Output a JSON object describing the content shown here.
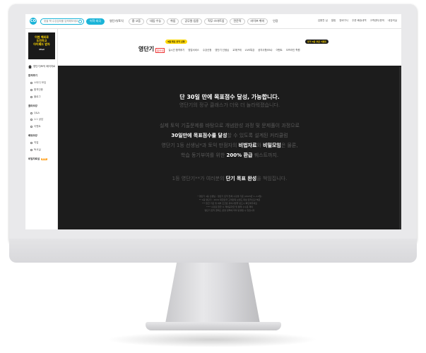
{
  "topbar": {
    "logo": "CO",
    "search_placeholder": "찾을 책·수강강좌를 입력해보세요",
    "menu": [
      "어학·외국",
      "영단기/토익",
      "중·고등",
      "대입·수능",
      "취업",
      "공무원·임용",
      "직무·스마트업",
      "전문직",
      "라이프·취미",
      "인강"
    ],
    "links": [
      "김용찬 님",
      "알림",
      "장바구니",
      "주문·배송내역",
      "고객센터/문의",
      "내강의실"
    ]
  },
  "sidebar": {
    "banner_line1": "이젠 해외로",
    "banner_line2": "도전하고",
    "banner_line3": "아이패드 받자",
    "banner_sub": "iPad",
    "home": "영단기/토익 페이지로",
    "sections": [
      {
        "title": "합격후기",
        "items": [
          "스터디 모임",
          "합격인증",
          "블로그"
        ]
      },
      {
        "title": "콜라보강",
        "items": [
          "Q&A",
          "1:1 상담",
          "이벤트"
        ]
      },
      {
        "title": "배워보강",
        "items": [
          "직업",
          "독서실"
        ]
      },
      {
        "title": "비밀자료실",
        "items": []
      }
    ],
    "new_badge": "NEW"
  },
  "subheader": {
    "brand": "영단기",
    "promo1": "4월 최신 토익 신청",
    "promo2": "토익 0원 쿠폰 이벤트",
    "nav": [
      "홍보대",
      "실시간 합격후기",
      "영업서비스",
      "수강신청",
      "영단기 선생님",
      "교재구매",
      "LIVE특강",
      "공지사항/FAQ",
      "이벤트",
      "오프라인 학원"
    ]
  },
  "content": {
    "headline": "단 30일 만에 목표점수 달성, 가능합니다.",
    "subline": "영단기의 정규 클래스가 더욱 더 놀라워졌습니다.",
    "para_line1": "실제 토익 기출문제를 바탕으로 개념완성 과정 및 문제풀이 과정으로",
    "para_line2_bold": "30일만에 목표점수를 달성",
    "para_line2_rest": "할 수 있도록 설계된 커리큘럼",
    "para_line3_a": "영단기 1등 선생님*과 토익 만점자의 ",
    "para_line3_b1": "비법자료",
    "para_line3_mid": "와 ",
    "para_line3_b2": "비밀모임",
    "para_line3_rest": "은 물론,",
    "para_line4_a": "학습 동기부여를 위한 ",
    "para_line4_b": "200% 환급",
    "para_line4_rest": " 퀘스트까지.",
    "closing_a": "1등 영단기**가 여러분의 ",
    "closing_b": "단기 목표 완성",
    "closing_rest": "을 책임집니다.",
    "fine1": "* 영단기 1등 선생님 : 영단기 토익 전체 수강생 기준 (2023년 1~12월)",
    "fine2": "** 1등 영단기 : 2024 대한민국 고객만족 브랜드 대상 토익인강 부문",
    "fine3": "*** 환급 기준 및 세부 조건은 유의사항을 반드시 확인해주세요",
    "fine4": "**** 수강료 환급 시 제세공과금 및 결제 수수료 제외",
    "fine5": "영단기 토익 클래스 운영 정책에 따라 변경될 수 있습니다"
  }
}
